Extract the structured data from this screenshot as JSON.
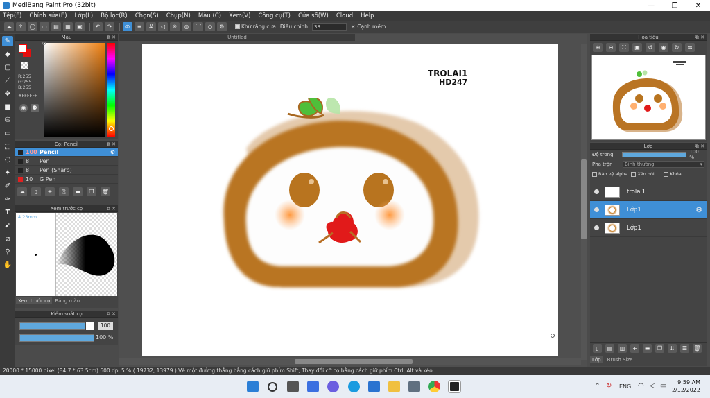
{
  "window": {
    "title": "MediBang Paint Pro (32bit)",
    "min": "—",
    "max": "❐",
    "close": "✕"
  },
  "menu": [
    "Tệp(F)",
    "Chỉnh sửa(E)",
    "Lớp(L)",
    "Bộ lọc(R)",
    "Chọn(S)",
    "Chụp(N)",
    "Màu (C)",
    "Xem(V)",
    "Công cụ(T)",
    "Cửa sổ(W)",
    "Cloud",
    "Help"
  ],
  "toolbar": {
    "antialias_label": "Khử răng cưa",
    "adjust_label": "Điều chỉnh",
    "adjust_value": "38",
    "soft_edge_label": "Cạnh mềm"
  },
  "color_panel": {
    "title": "Màu",
    "r": "R:255",
    "g": "G:255",
    "b": "B:255",
    "hex": "#FFFFFF"
  },
  "brush_panel": {
    "title": "Cọ: Pencil",
    "items": [
      {
        "size": "100",
        "name": "Pencil",
        "color": "#222222"
      },
      {
        "size": "8",
        "name": "Pen",
        "color": "#222222"
      },
      {
        "size": "8",
        "name": "Pen (Sharp)",
        "color": "#222222"
      },
      {
        "size": "10",
        "name": "G Pen",
        "color": "#e02020"
      }
    ]
  },
  "preview_panel": {
    "title": "Xem trước cọ",
    "size_text": "4.23mm",
    "tab1": "Xem trước cọ",
    "tab2": "Bảng màu"
  },
  "control_panel": {
    "title": "Kiểm soát cọ",
    "size_value": "100",
    "opacity_value": "100 %",
    "size_fraction": 0.88,
    "opacity_fraction": 1.0
  },
  "canvas": {
    "tab": "Untitled",
    "signature_line1": "TROLAI1",
    "signature_line2": "HD247"
  },
  "navigator": {
    "title": "Hoa tiêu"
  },
  "layer_panel": {
    "title": "Lớp",
    "opacity_label": "Độ trong",
    "opacity_value": "100 %",
    "blend_label": "Pha trộn",
    "blend_value": "Bình thường",
    "protect_alpha": "Bảo vệ alpha",
    "clip": "Xén bớt",
    "lock": "Khóa",
    "layers": [
      {
        "name": "trolai1"
      },
      {
        "name": "Lớp1"
      },
      {
        "name": "Lớp1"
      }
    ],
    "tab1": "Lớp",
    "tab2": "Brush Size"
  },
  "status": "20000 * 15000 pixel   (84.7 * 63.5cm)   600 dpi   5 %   ( 19732, 13979 )   Vẽ một đường thẳng bằng cách giữ phím Shift, Thay đổi cỡ cọ bằng cách giữ phím Ctrl, Alt và kéo",
  "taskbar": {
    "lang": "ENG",
    "time": "9:59 AM",
    "date": "2/12/2022"
  }
}
